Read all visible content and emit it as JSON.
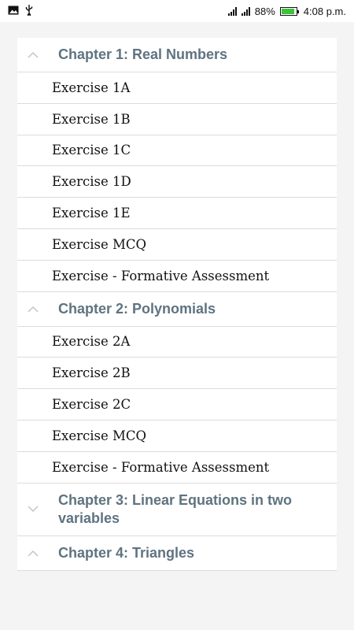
{
  "status_bar": {
    "battery_percent": "88%",
    "time": "4:08 p.m.",
    "battery_level": 0.88,
    "battery_color": "#3cc23c",
    "icons": [
      "image-icon",
      "usb-icon",
      "signal-icon",
      "signal-icon",
      "battery-icon"
    ]
  },
  "chapters": [
    {
      "title": "Chapter 1: Real Numbers",
      "expanded": true,
      "exercises": [
        "Exercise 1A",
        "Exercise 1B",
        "Exercise 1C",
        "Exercise 1D",
        "Exercise 1E",
        "Exercise MCQ",
        "Exercise - Formative Assessment"
      ]
    },
    {
      "title": "Chapter 2: Polynomials",
      "expanded": true,
      "exercises": [
        "Exercise 2A",
        "Exercise 2B",
        "Exercise 2C",
        "Exercise MCQ",
        "Exercise - Formative Assessment"
      ]
    },
    {
      "title": "Chapter 3: Linear Equations in two variables",
      "expanded": false,
      "exercises": []
    },
    {
      "title": "Chapter 4: Triangles",
      "expanded": true,
      "exercises": []
    }
  ],
  "colors": {
    "chapter_title": "#5f7380",
    "divider": "#dcdcdc",
    "background": "#f4f4f4"
  }
}
